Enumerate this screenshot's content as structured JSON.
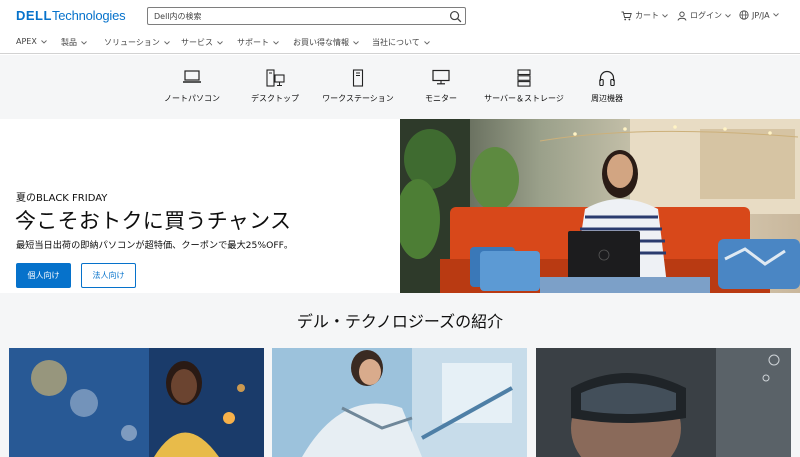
{
  "header": {
    "logo_brand": "DELL",
    "logo_suffix": "Technologies",
    "search_placeholder": "Dell内の検索",
    "cart_label": "カート",
    "login_label": "ログイン",
    "locale_label": "JP/JA"
  },
  "nav": {
    "items": [
      "APEX",
      "製品",
      "ソリューション",
      "サービス",
      "サポート",
      "お買い得な情報",
      "当社について"
    ]
  },
  "categories": [
    {
      "label": "ノートパソコン",
      "icon": "laptop-icon"
    },
    {
      "label": "デスクトップ",
      "icon": "desktop-icon"
    },
    {
      "label": "ワークステーション",
      "icon": "workstation-icon"
    },
    {
      "label": "モニター",
      "icon": "monitor-icon"
    },
    {
      "label": "サーバー＆ストレージ",
      "icon": "server-icon"
    },
    {
      "label": "周辺機器",
      "icon": "headphones-icon"
    }
  ],
  "hero": {
    "eyebrow": "夏のBLACK FRIDAY",
    "title": "今こそおトクに買うチャンス",
    "subtitle": "最短当日出荷の即納パソコンが超特価、クーポンで最大25%OFF。",
    "primary_button": "個人向け",
    "secondary_button": "法人向け"
  },
  "intro": {
    "title": "デル・テクノロジーズの紹介"
  },
  "colors": {
    "accent": "#0672cb",
    "text": "#0e0e0e",
    "muted": "#444444",
    "panel_bg": "#f5f6f7"
  }
}
